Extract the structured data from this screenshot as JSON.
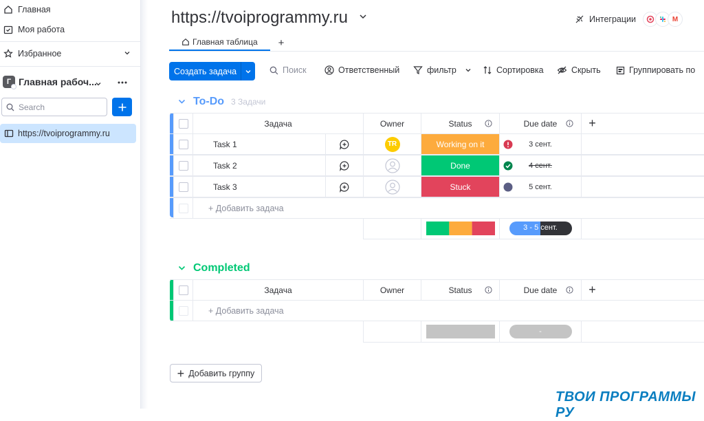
{
  "sidebar": {
    "home": "Главная",
    "my_work": "Моя работа",
    "favorites": "Избранное",
    "workspace_letter": "Г",
    "workspace_name": "Главная рабоч...",
    "search_placeholder": "Search",
    "board": "https://tvoiprogrammy.ru"
  },
  "header": {
    "title": "https://tvoiprogrammy.ru",
    "integrations": "Интеграции",
    "tab_main": "Главная таблица",
    "tab_add": "+"
  },
  "toolbar": {
    "create": "Создать задача",
    "search": "Поиск",
    "owner": "Ответственный",
    "filter": "фильтр",
    "sort": "Сортировка",
    "hide": "Скрыть",
    "group_by": "Группировать по"
  },
  "columns": {
    "task": "Задача",
    "owner": "Owner",
    "status": "Status",
    "due": "Due date",
    "add": "+"
  },
  "groups": [
    {
      "title": "To-Do",
      "count": "3 Задачи",
      "color": "#579bfc",
      "tasks": [
        {
          "name": "Task 1",
          "owner": "TR",
          "status": "Working on it",
          "status_color": "#fdab3d",
          "due": "3 сент.",
          "due_icon": "alert-icon"
        },
        {
          "name": "Task 2",
          "owner": "",
          "status": "Done",
          "status_color": "#00c875",
          "due": "4 сент.",
          "due_icon": "check-icon"
        },
        {
          "name": "Task 3",
          "owner": "",
          "status": "Stuck",
          "status_color": "#e2445c",
          "due": "5 сент.",
          "due_icon": "dot-icon"
        }
      ],
      "add_task": "+ Добавить задача",
      "summary_due": "3 - 5 сент."
    },
    {
      "title": "Completed",
      "count": "",
      "color": "#00c875",
      "tasks": [],
      "add_task": "+ Добавить задача",
      "summary_due": "-"
    }
  ],
  "add_group": "Добавить группу",
  "watermark": "ТВОИ ПРОГРАММЫ РУ"
}
